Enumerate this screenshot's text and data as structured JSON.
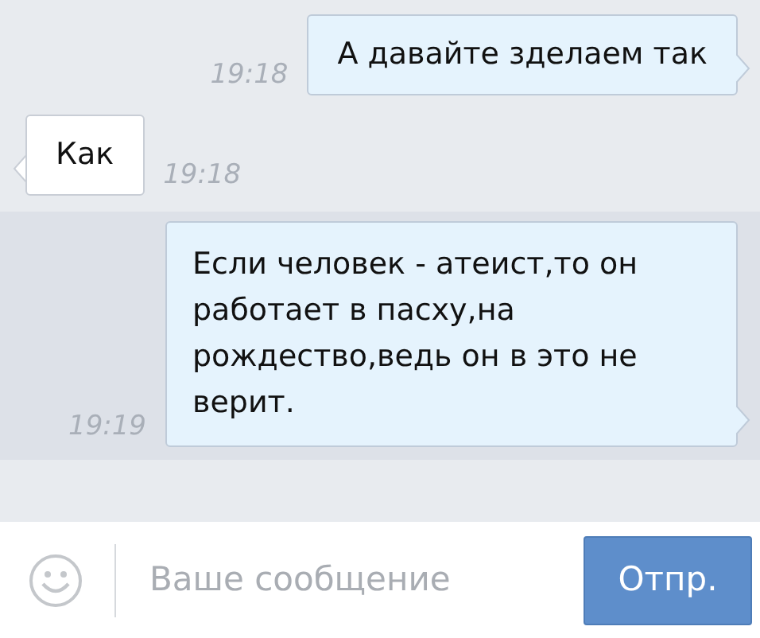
{
  "messages": [
    {
      "kind": "outgoing",
      "text": "А давайте зделаем так",
      "time": "19:18",
      "selected": false
    },
    {
      "kind": "incoming",
      "text": "Как",
      "time": "19:18",
      "selected": false
    },
    {
      "kind": "outgoing",
      "text": "Если человек - атеист,то он работает в пасху,на рождество,ведь он в это не верит.",
      "time": "19:19",
      "selected": true
    }
  ],
  "composer": {
    "placeholder": "Ваше сообщение",
    "send_button": "Отпр."
  }
}
